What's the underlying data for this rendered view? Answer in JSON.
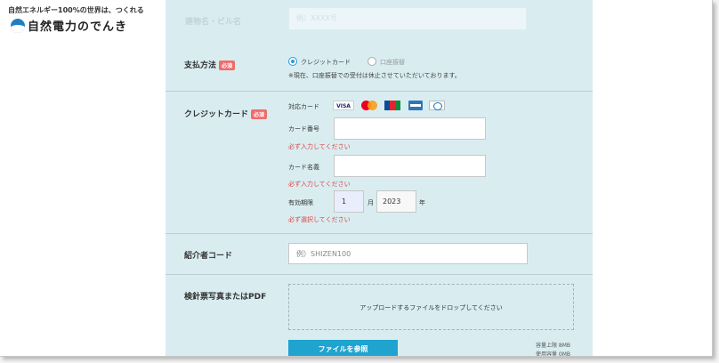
{
  "header": {
    "tagline": "自然エネルギー100%の世界は、つくれる",
    "logo_text": "自然電力のでんき",
    "logo_icon": "logo-drop-icon"
  },
  "form": {
    "top_row": {
      "label": "建物名・ビル名",
      "placeholder": "例）XXXX号"
    },
    "payment": {
      "label": "支払方法",
      "required": "必須",
      "options": [
        {
          "label": "クレジットカード",
          "selected": true
        },
        {
          "label": "口座振替",
          "selected": false
        }
      ],
      "note": "※現在、口座振替での受付は休止させていただいております。"
    },
    "credit_card": {
      "label": "クレジットカード",
      "required": "必須",
      "supported_label": "対応カード",
      "brands": [
        "VISA",
        "Mastercard",
        "JCB",
        "American Express",
        "Diners Club"
      ],
      "number_label": "カード番号",
      "number_error": "必ず入力してください",
      "holder_label": "カード名義",
      "holder_error": "必ず入力してください",
      "expiry_label": "有効期限",
      "month_value": "1",
      "month_unit": "月",
      "year_value": "2023",
      "year_unit": "年",
      "expiry_error": "必ず選択してください"
    },
    "referral": {
      "label": "紹介者コード",
      "placeholder": "例）SHIZEN100"
    },
    "upload": {
      "label": "検針票写真またはPDF",
      "drop_text": "アップロードするファイルをドロップしてください",
      "button": "ファイルを参照",
      "capacity_limit": "容量上限 8MB",
      "capacity_used": "使用容量 0MB"
    }
  },
  "colors": {
    "panel": "#d9edf1",
    "accent": "#1fa3cf",
    "required_badge": "#ef6b6b",
    "error": "#e04444"
  }
}
